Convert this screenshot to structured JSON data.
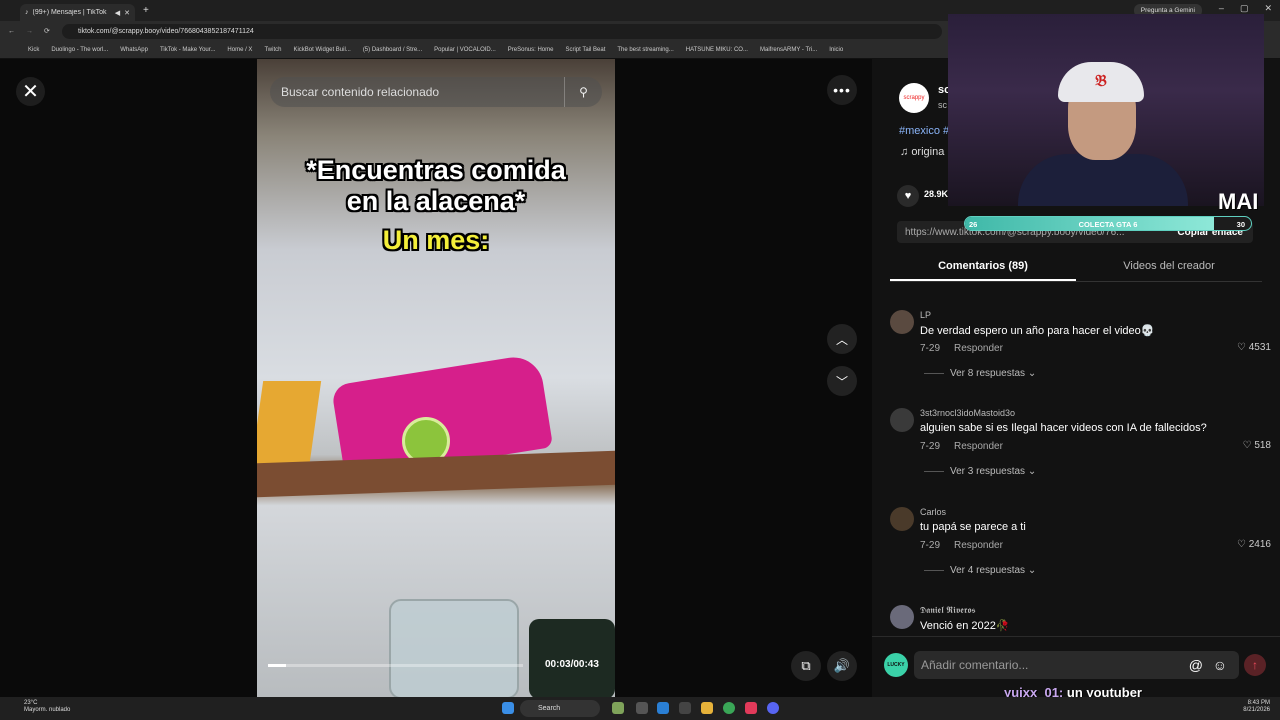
{
  "browser": {
    "tab_title": "(99+) Mensajes | TikTok",
    "url": "tiktok.com/@scrappy.booy/video/7668043852187471124",
    "gemini_label": "Pregunta a Gemini",
    "bookmarks": [
      "Kick",
      "Duolingo - The worl...",
      "WhatsApp",
      "TikTok - Make Your...",
      "Home / X",
      "Twitch",
      "KickBot Widget Buil...",
      "(5) Dashboard / Stre...",
      "Popular | VOCALOID...",
      "PreSonus: Home",
      "Script Tail Beat",
      "The best streaming...",
      "HATSUNE MIKU: CO...",
      "MaifrensARMY - Tri...",
      "Inicio"
    ]
  },
  "video": {
    "search_placeholder": "Buscar contenido relacionado",
    "caption_line1": "*Encuentras comida",
    "caption_line2": "en la alacena*",
    "caption_line3": "Un mes:",
    "time": "00:03/00:43",
    "progress": 0.07
  },
  "creator": {
    "avatar_text": "scrappy",
    "name": "sc",
    "handle": "sc",
    "tags": "#mexico #",
    "music": "origina",
    "likes": "28.9K",
    "link": "https://www.tiktok.com/@scrappy.booy/video/76...",
    "copy_label": "Copiar enlace"
  },
  "tabs": {
    "comments": "Comentarios (89)",
    "creator_videos": "Videos del creador"
  },
  "comments": [
    {
      "user": "LP",
      "text": "De verdad espero un año para hacer el video💀",
      "date": "7-29",
      "reply": "Responder",
      "likes": "4531",
      "more": "Ver 8 respuestas"
    },
    {
      "user": "3st3rnocl3idoMastoid3o",
      "text": "alguien sabe si es Ilegal hacer videos con IA de fallecidos?",
      "date": "7-29",
      "reply": "Responder",
      "likes": "518",
      "more": "Ver 3 respuestas"
    },
    {
      "user": "Carlos",
      "text": "tu papá se parece a ti",
      "date": "7-29",
      "reply": "Responder",
      "likes": "2416",
      "more": "Ver 4 respuestas"
    },
    {
      "user": "𝕯𝖆𝖓𝖎𝖊𝖑 𝕽𝖎𝖛𝖊𝖗𝖔𝖘",
      "text": "Venció en 2022🥀",
      "date": "",
      "reply": "",
      "likes": "",
      "more": ""
    }
  ],
  "comment_input": {
    "placeholder": "Añadir comentario...",
    "my_avatar": "LUCKY"
  },
  "overlay": {
    "name": "MAI",
    "goal_label": "COLECTA GTA 6",
    "goal_current": "26",
    "goal_target": "30",
    "goal_fraction": 0.87,
    "chat_user": "yuixx_01:",
    "chat_text": " un youtuber"
  },
  "taskbar": {
    "temp": "23°C",
    "weather": "Mayorm. nublado",
    "search": "Search",
    "time": "8:43 PM",
    "date": "8/21/2026"
  }
}
